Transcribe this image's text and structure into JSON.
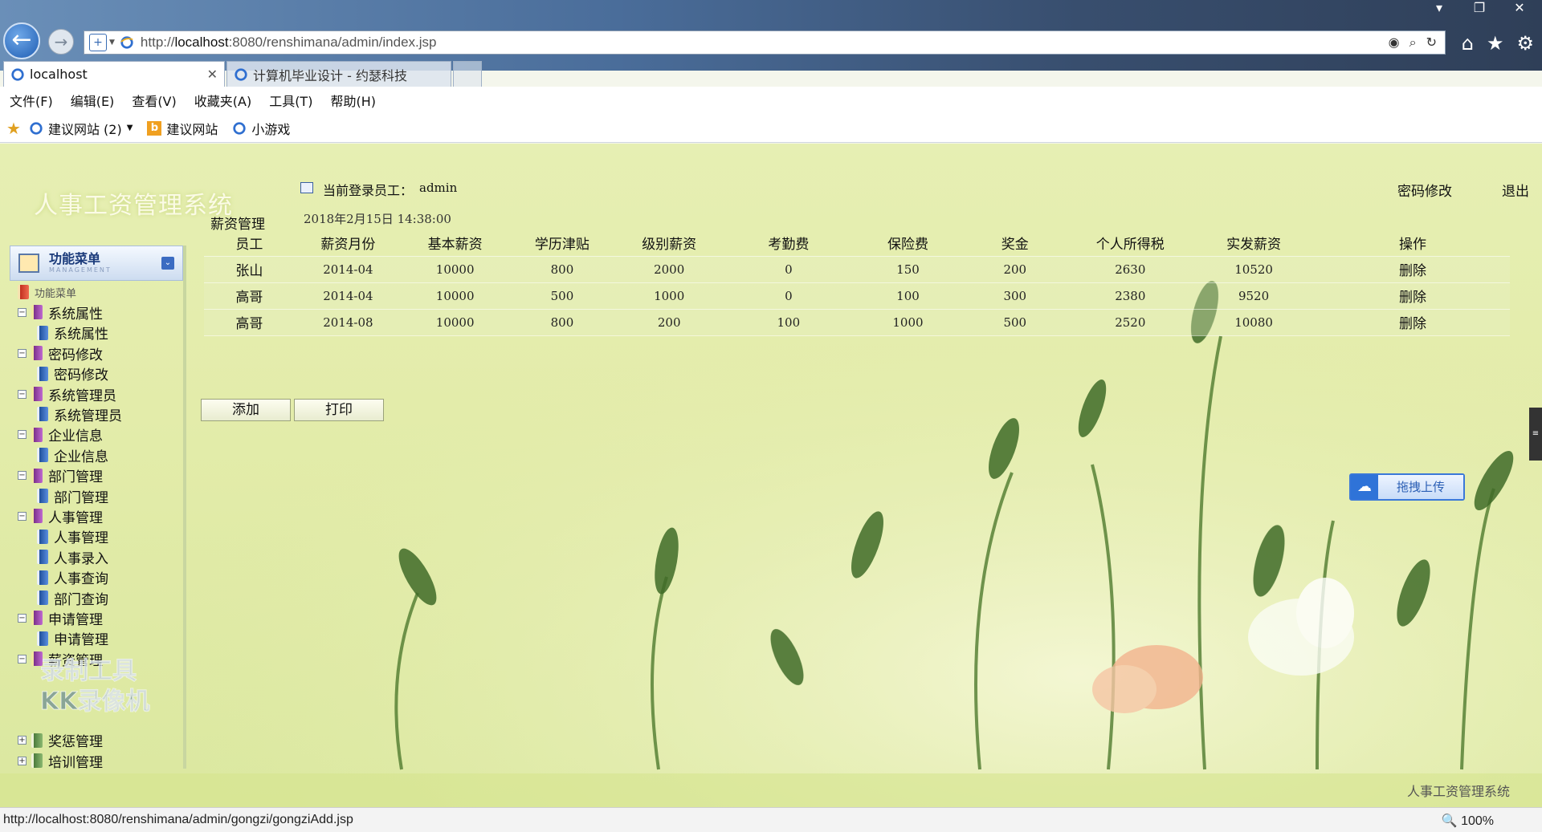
{
  "browser": {
    "url_prefix": "http://",
    "url_host": "localhost",
    "url_rest": ":8080/renshimana/admin/index.jsp",
    "tabs": [
      {
        "label": "localhost"
      },
      {
        "label": "计算机毕业设计 - 约瑟科技"
      }
    ],
    "menu": [
      "文件(F)",
      "编辑(E)",
      "查看(V)",
      "收藏夹(A)",
      "工具(T)",
      "帮助(H)"
    ],
    "favorites": [
      {
        "label": "建议网站 (2)"
      },
      {
        "label": "建议网站"
      },
      {
        "label": "小游戏"
      }
    ],
    "status_url": "http://localhost:8080/renshimana/admin/gongzi/gongziAdd.jsp",
    "zoom": "100%"
  },
  "header": {
    "system_title": "人事工资管理系统",
    "login_label": "当前登录员工：",
    "login_user": "admin",
    "login_time": "2018年2月15日 14:38:00",
    "password_link": "密码修改",
    "logout_link": "退出"
  },
  "sidebar": {
    "header_title": "功能菜单",
    "header_sub": "MANAGEMENT",
    "root": "功能菜单",
    "groups": [
      {
        "label": "系统属性",
        "items": [
          "系统属性"
        ]
      },
      {
        "label": "密码修改",
        "items": [
          "密码修改"
        ]
      },
      {
        "label": "系统管理员",
        "items": [
          "系统管理员"
        ]
      },
      {
        "label": "企业信息",
        "items": [
          "企业信息"
        ]
      },
      {
        "label": "部门管理",
        "items": [
          "部门管理"
        ]
      },
      {
        "label": "人事管理",
        "items": [
          "人事管理",
          "人事录入",
          "人事查询",
          "部门查询"
        ]
      },
      {
        "label": "申请管理",
        "items": [
          "申请管理"
        ]
      },
      {
        "label": "薪资管理",
        "items": []
      },
      {
        "label": "奖惩管理",
        "items": []
      },
      {
        "label": "培训管理",
        "items": []
      }
    ]
  },
  "watermark": {
    "line1": "录制工具",
    "line2": "KK录像机"
  },
  "salary": {
    "title": "薪资管理",
    "columns": [
      "员工",
      "薪资月份",
      "基本薪资",
      "学历津贴",
      "级别薪资",
      "考勤费",
      "保险费",
      "奖金",
      "个人所得税",
      "实发薪资",
      "操作"
    ],
    "rows": [
      [
        "张山",
        "2014-04",
        "10000",
        "800",
        "2000",
        "0",
        "150",
        "200",
        "2630",
        "10520",
        "删除"
      ],
      [
        "高哥",
        "2014-04",
        "10000",
        "500",
        "1000",
        "0",
        "100",
        "300",
        "2380",
        "9520",
        "删除"
      ],
      [
        "高哥",
        "2014-08",
        "10000",
        "800",
        "200",
        "100",
        "1000",
        "500",
        "2520",
        "10080",
        "删除"
      ]
    ],
    "add_label": "添加",
    "print_label": "打印"
  },
  "upload_widget": {
    "label": "拖拽上传"
  },
  "footer": {
    "text": "人事工资管理系统"
  }
}
